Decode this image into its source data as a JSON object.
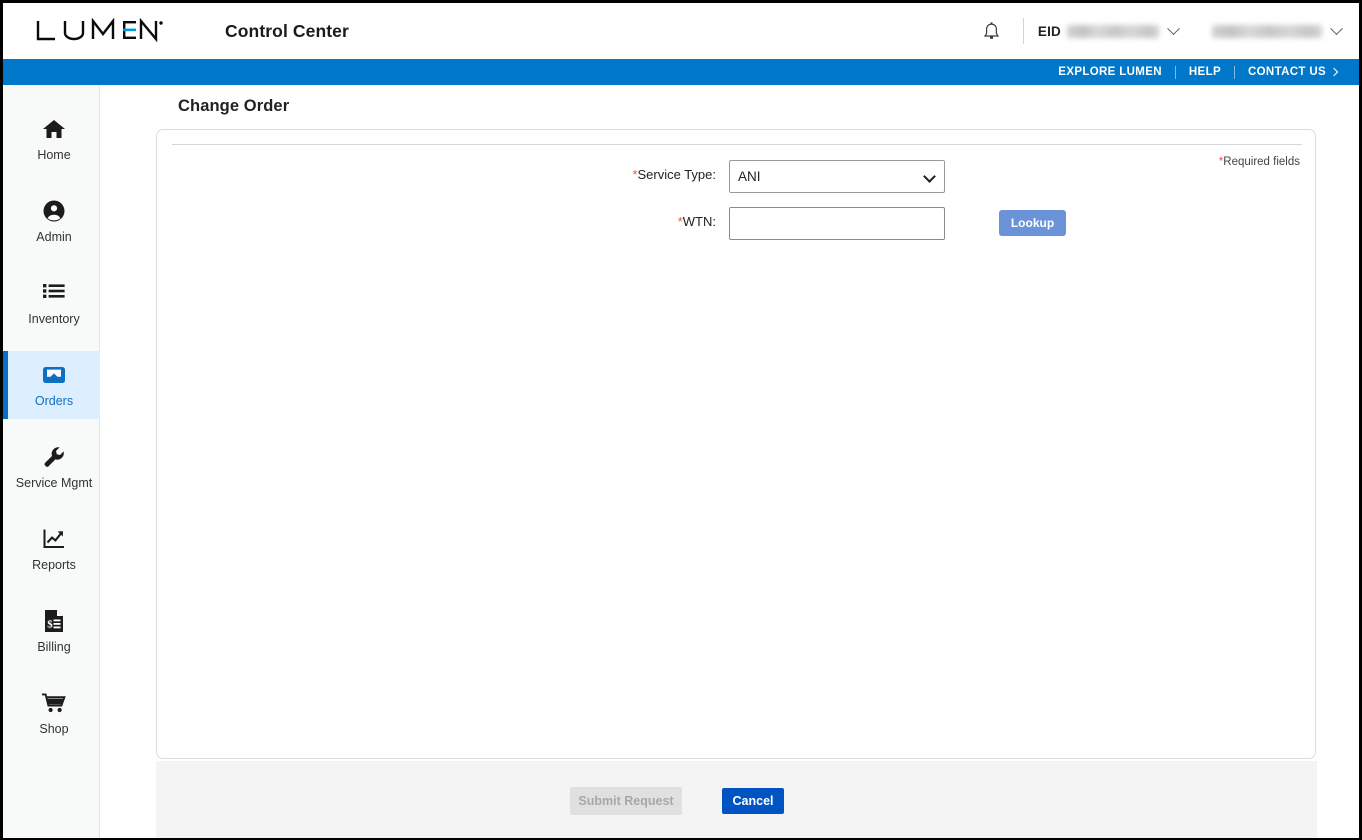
{
  "header": {
    "logo_text": "LUMEN",
    "logo_mark": "lumen-logo",
    "app_title": "Control Center",
    "bell_icon": "notification-bell-icon",
    "eid_label": "EID",
    "eid_value": "",
    "eid_caret_icon": "chevron-down-icon",
    "user_value": "",
    "user_caret_icon": "chevron-down-icon"
  },
  "bluebar": {
    "links": [
      {
        "label": "EXPLORE LUMEN"
      },
      {
        "label": "HELP"
      },
      {
        "label": "CONTACT US"
      }
    ],
    "contact_chevron_icon": "chevron-right-icon",
    "background": "#0077c8"
  },
  "sidebar": {
    "items": [
      {
        "label": "Home",
        "icon": "home-icon",
        "active": false
      },
      {
        "label": "Admin",
        "icon": "user-circle-icon",
        "active": false
      },
      {
        "label": "Inventory",
        "icon": "list-icon",
        "active": false
      },
      {
        "label": "Orders",
        "icon": "inbox-tray-icon",
        "active": true
      },
      {
        "label": "Service Mgmt",
        "icon": "wrench-icon",
        "active": false
      },
      {
        "label": "Reports",
        "icon": "chart-line-icon",
        "active": false
      },
      {
        "label": "Billing",
        "icon": "invoice-icon",
        "active": false
      },
      {
        "label": "Shop",
        "icon": "shopping-cart-icon",
        "active": false
      }
    ],
    "active_accent": "#0b6ec4",
    "active_background": "#ddeeff"
  },
  "main": {
    "page_title": "Change Order",
    "required_note_star": "*",
    "required_note": "Required fields",
    "form": {
      "service_type": {
        "label_star": "*",
        "label": "Service Type:",
        "value": "ANI",
        "options": [
          "ANI"
        ],
        "caret_icon": "chevron-down-icon"
      },
      "wtn": {
        "label_star": "*",
        "label": "WTN:",
        "value": "",
        "placeholder": ""
      },
      "lookup_button": "Lookup",
      "lookup_button_color": "#6b94d8"
    }
  },
  "footer": {
    "submit_label": "Submit Request",
    "submit_disabled": true,
    "cancel_label": "Cancel",
    "cancel_color": "#0053c2"
  }
}
